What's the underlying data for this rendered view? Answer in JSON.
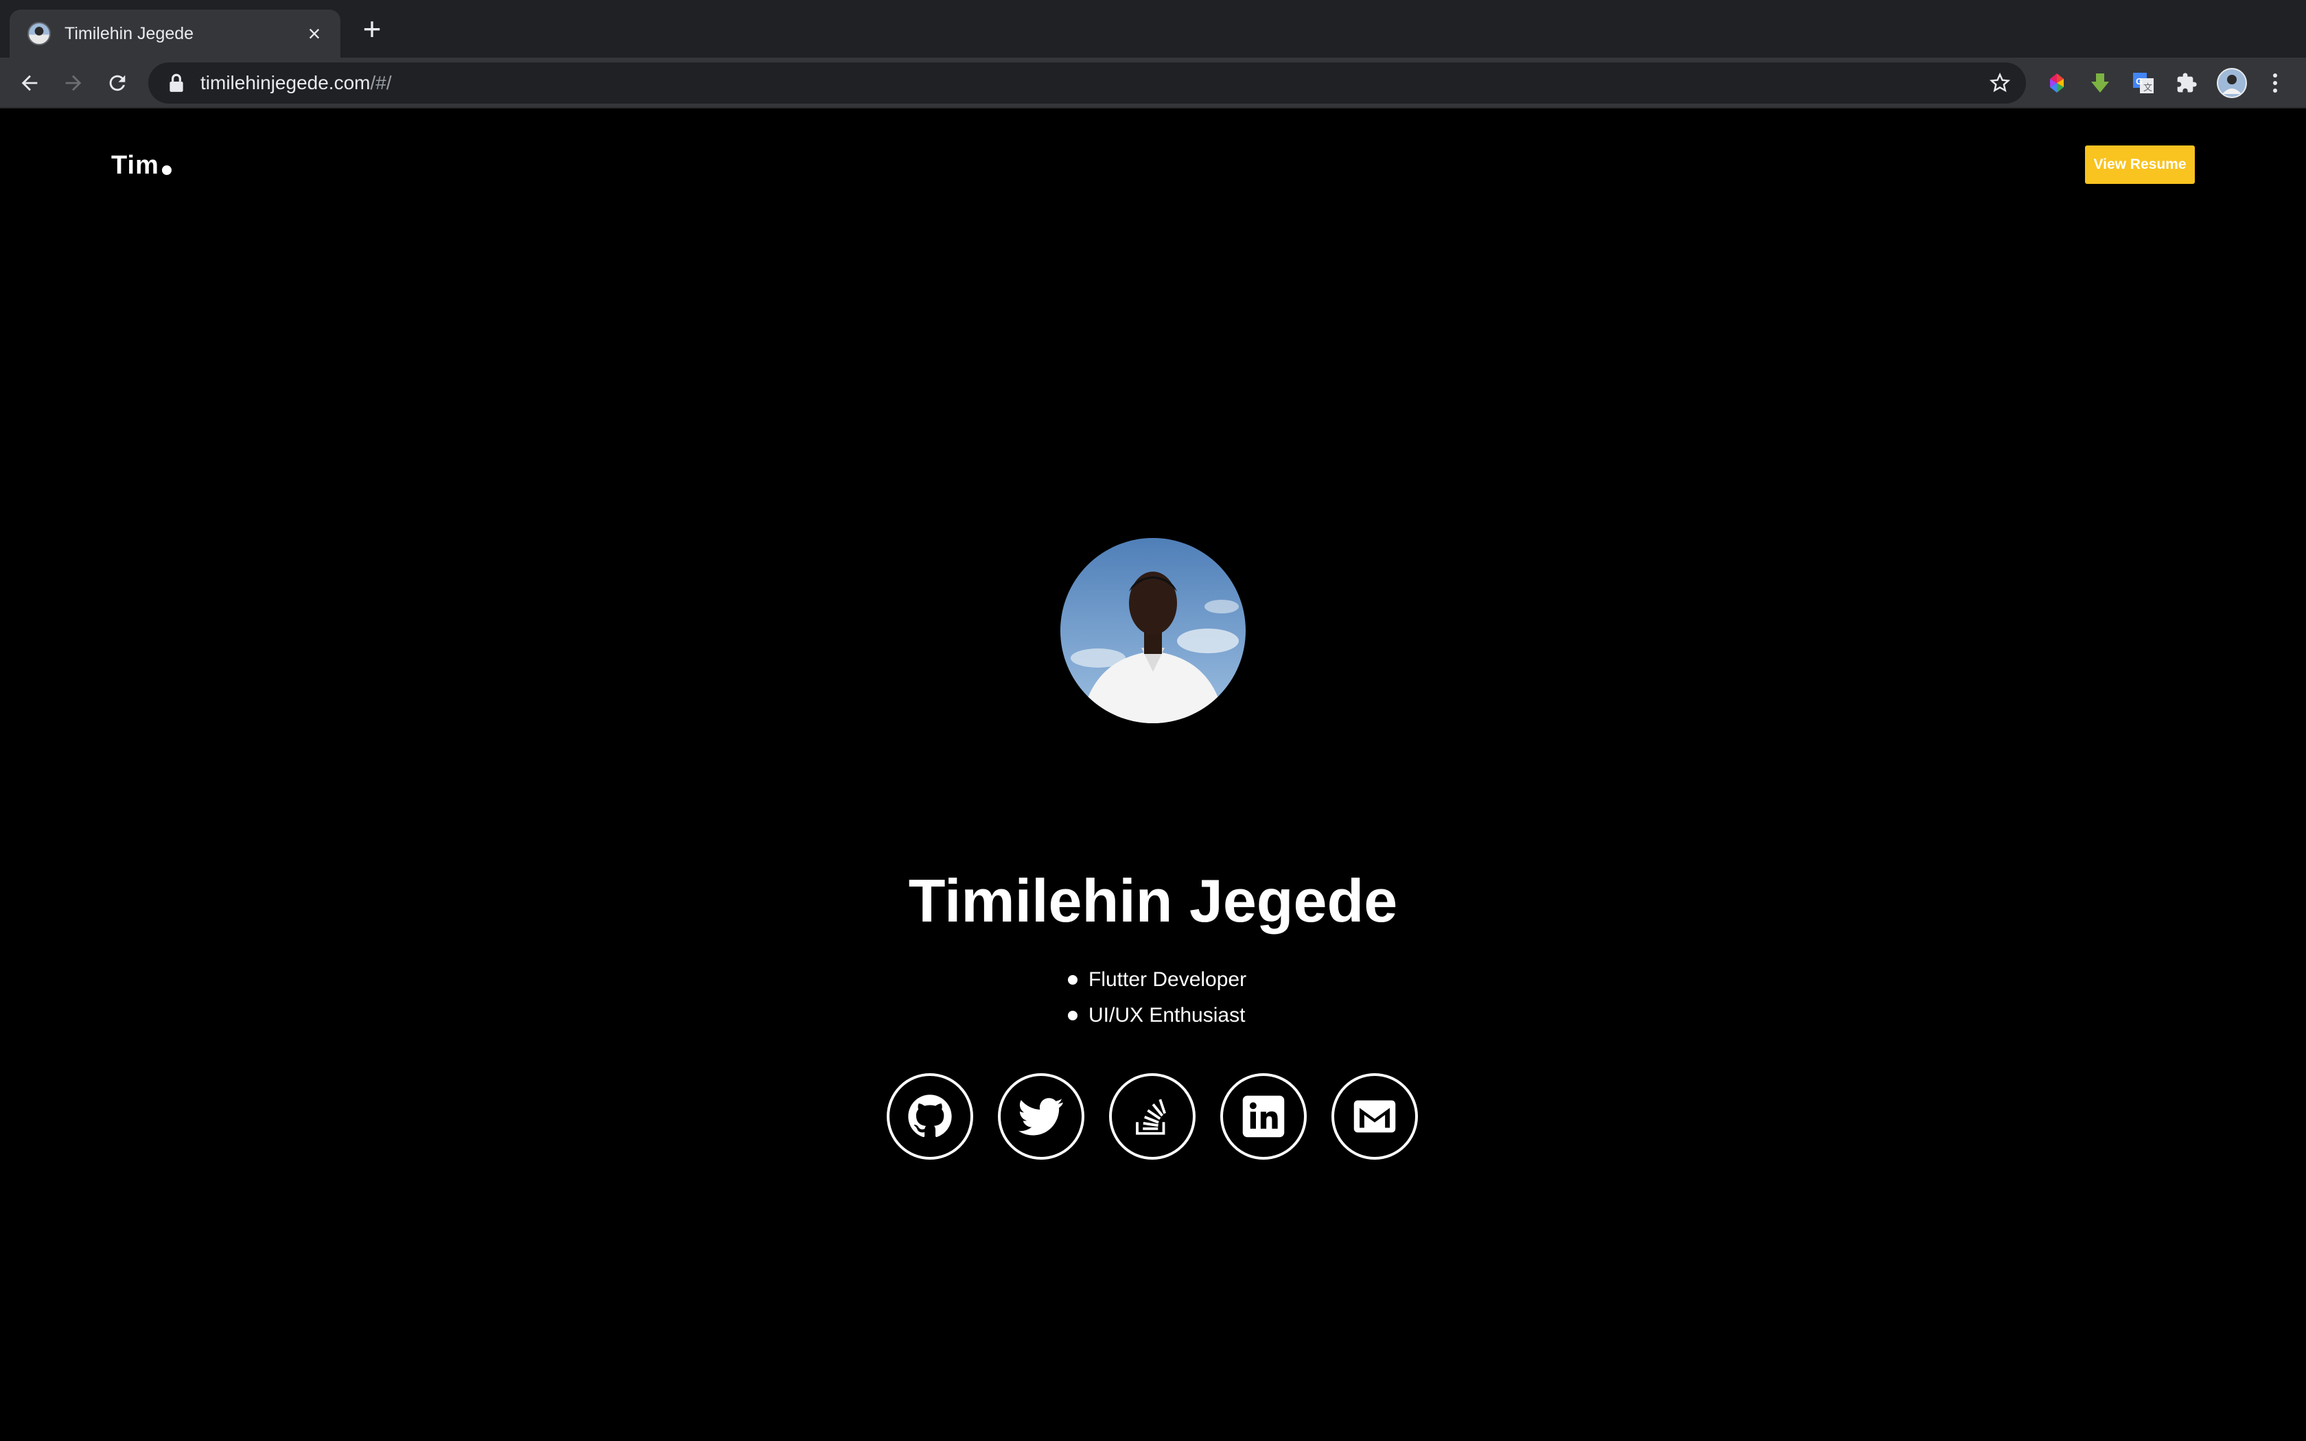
{
  "browser": {
    "tab_title": "Timilehin Jegede",
    "url_host": "timilehinjegede.com",
    "url_path": "/#/"
  },
  "site": {
    "logo_text": "Tim",
    "resume_button": "View Resume",
    "name": "Timilehin Jegede",
    "roles": [
      "Flutter Developer",
      "UI/UX Enthusiast"
    ],
    "socials": [
      "github-icon",
      "twitter-icon",
      "stackoverflow-icon",
      "linkedin-icon",
      "gmail-icon"
    ]
  },
  "colors": {
    "background": "#000000",
    "accent": "#f9c320",
    "text": "#ffffff"
  }
}
